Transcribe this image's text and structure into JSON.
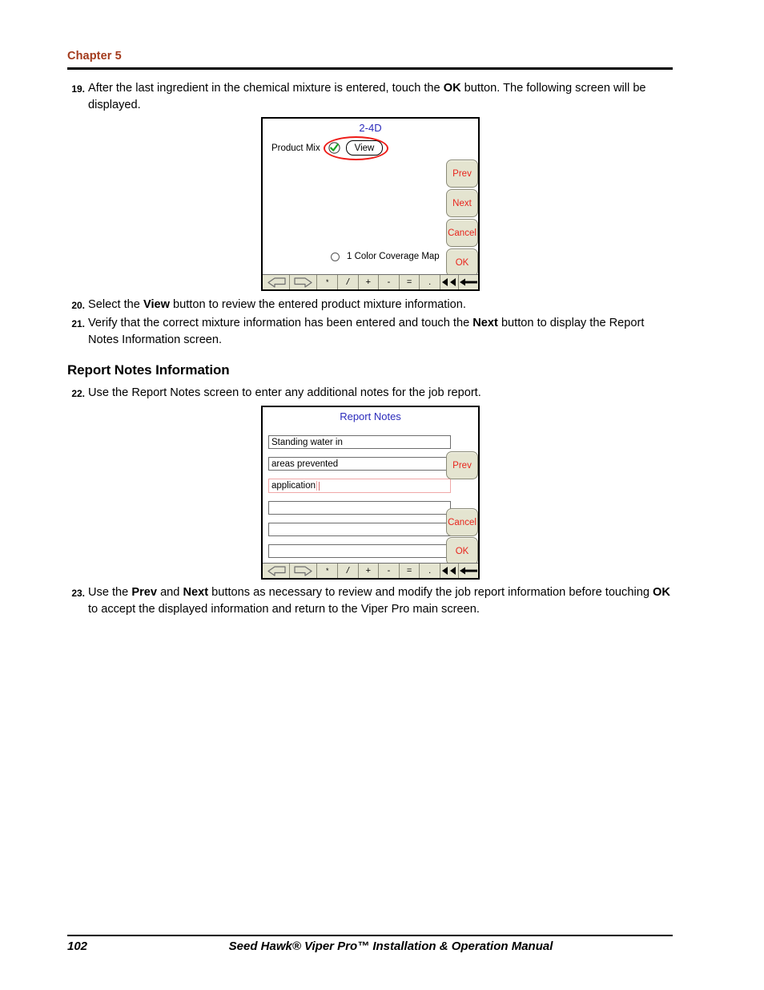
{
  "header": {
    "chapter": "Chapter 5"
  },
  "footer": {
    "page_number": "102",
    "manual_title": "Seed Hawk® Viper Pro™ Installation & Operation Manual"
  },
  "steps": {
    "s19": {
      "num": "19.",
      "t1": "After the last ingredient in the chemical mixture is entered, touch the ",
      "b1": "OK",
      "t2": " button. The following screen will be displayed."
    },
    "s20": {
      "num": "20.",
      "t1": "Select the ",
      "b1": "View",
      "t2": " button to review the entered product mixture information."
    },
    "s21": {
      "num": "21.",
      "t1": "Verify that the correct mixture information has been entered and touch the ",
      "b1": "Next",
      "t2": " button to display the Report Notes Information screen."
    },
    "s22": {
      "num": "22.",
      "t1": "Use the Report Notes screen to enter any additional notes for the job report."
    },
    "s23": {
      "num": "23.",
      "t1": "Use the ",
      "b1": "Prev",
      "t2": " and ",
      "b2": "Next",
      "t3": " buttons as necessary to review and modify the job report information before touching ",
      "b3": "OK",
      "t4": " to accept the displayed information and return to the Viper Pro main screen."
    }
  },
  "section_heading": "Report Notes Information",
  "screen_product_mix": {
    "title": "2-4D",
    "product_mix_label": "Product Mix",
    "view_button": "View",
    "coverage_map_label": "1 Color Coverage Map",
    "buttons": {
      "prev": "Prev",
      "next": "Next",
      "cancel": "Cancel",
      "ok": "OK"
    },
    "keypad": [
      "↰",
      "↱",
      "*",
      "/",
      "+",
      "-",
      "=",
      ".",
      "◀◀",
      "←"
    ],
    "annotation_color": "#ee1b17",
    "title_color": "#2b2bbb",
    "button_text_color": "#e8251d",
    "button_fill_color": "#e4e4d0"
  },
  "screen_report_notes": {
    "title": "Report Notes",
    "fields": [
      {
        "value": "Standing water in",
        "active": false
      },
      {
        "value": "areas prevented",
        "active": false
      },
      {
        "value": "application",
        "active": true
      },
      {
        "value": "",
        "active": false
      },
      {
        "value": "",
        "active": false
      },
      {
        "value": "",
        "active": false
      }
    ],
    "buttons": {
      "prev": "Prev",
      "cancel": "Cancel",
      "ok": "OK"
    },
    "keypad": [
      "↰",
      "↱",
      "*",
      "/",
      "+",
      "-",
      "=",
      ".",
      "◀◀",
      "←"
    ],
    "title_color": "#2b2bbb",
    "active_field_border": "#f0a7a7"
  }
}
